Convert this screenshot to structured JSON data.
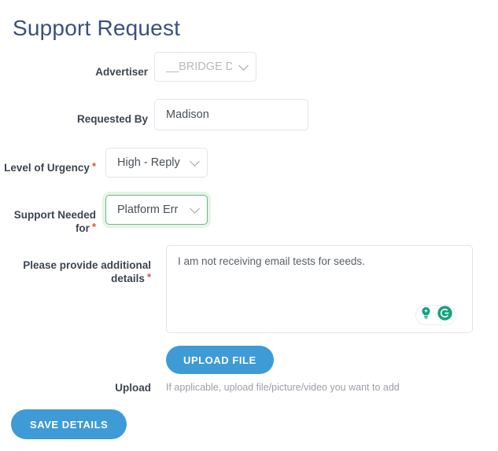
{
  "page": {
    "title": "Support Request",
    "title_color": "#39517c",
    "accent_color": "#3e9bd5",
    "required_mark": "*",
    "required_color": "#e8503a",
    "focus_border_color": "#6cb980"
  },
  "fields": {
    "advertiser": {
      "label": "Advertiser",
      "value": "__BRIDGE D",
      "required": false,
      "control": "select",
      "chevron_icon": "chevron-down-icon"
    },
    "requested_by": {
      "label": "Requested By",
      "value": "Madison",
      "required": false,
      "control": "text"
    },
    "urgency": {
      "label": "Level of Urgency",
      "value": "High - Reply",
      "required": true,
      "control": "select",
      "chevron_icon": "chevron-down-icon"
    },
    "support_needed": {
      "label": "Support Needed\nfor",
      "value": "Platform Err",
      "required": true,
      "control": "select",
      "focused": true,
      "chevron_icon": "chevron-down-icon"
    },
    "details": {
      "label": "Please provide additional\ndetails",
      "value": "I am not receiving email tests for seeds.",
      "required": true,
      "control": "textarea"
    },
    "upload": {
      "label": "Upload",
      "button_label": "UPLOAD FILE",
      "help_text": "If applicable, upload file/picture/video you want to add",
      "required": false
    }
  },
  "grammarly": {
    "lightbulb_icon": "lightbulb-idea-icon",
    "logo_icon": "grammarly-logo-icon",
    "color": "#10a37f",
    "logo_color": "#15a37f"
  },
  "actions": {
    "save_label": "SAVE DETAILS"
  }
}
